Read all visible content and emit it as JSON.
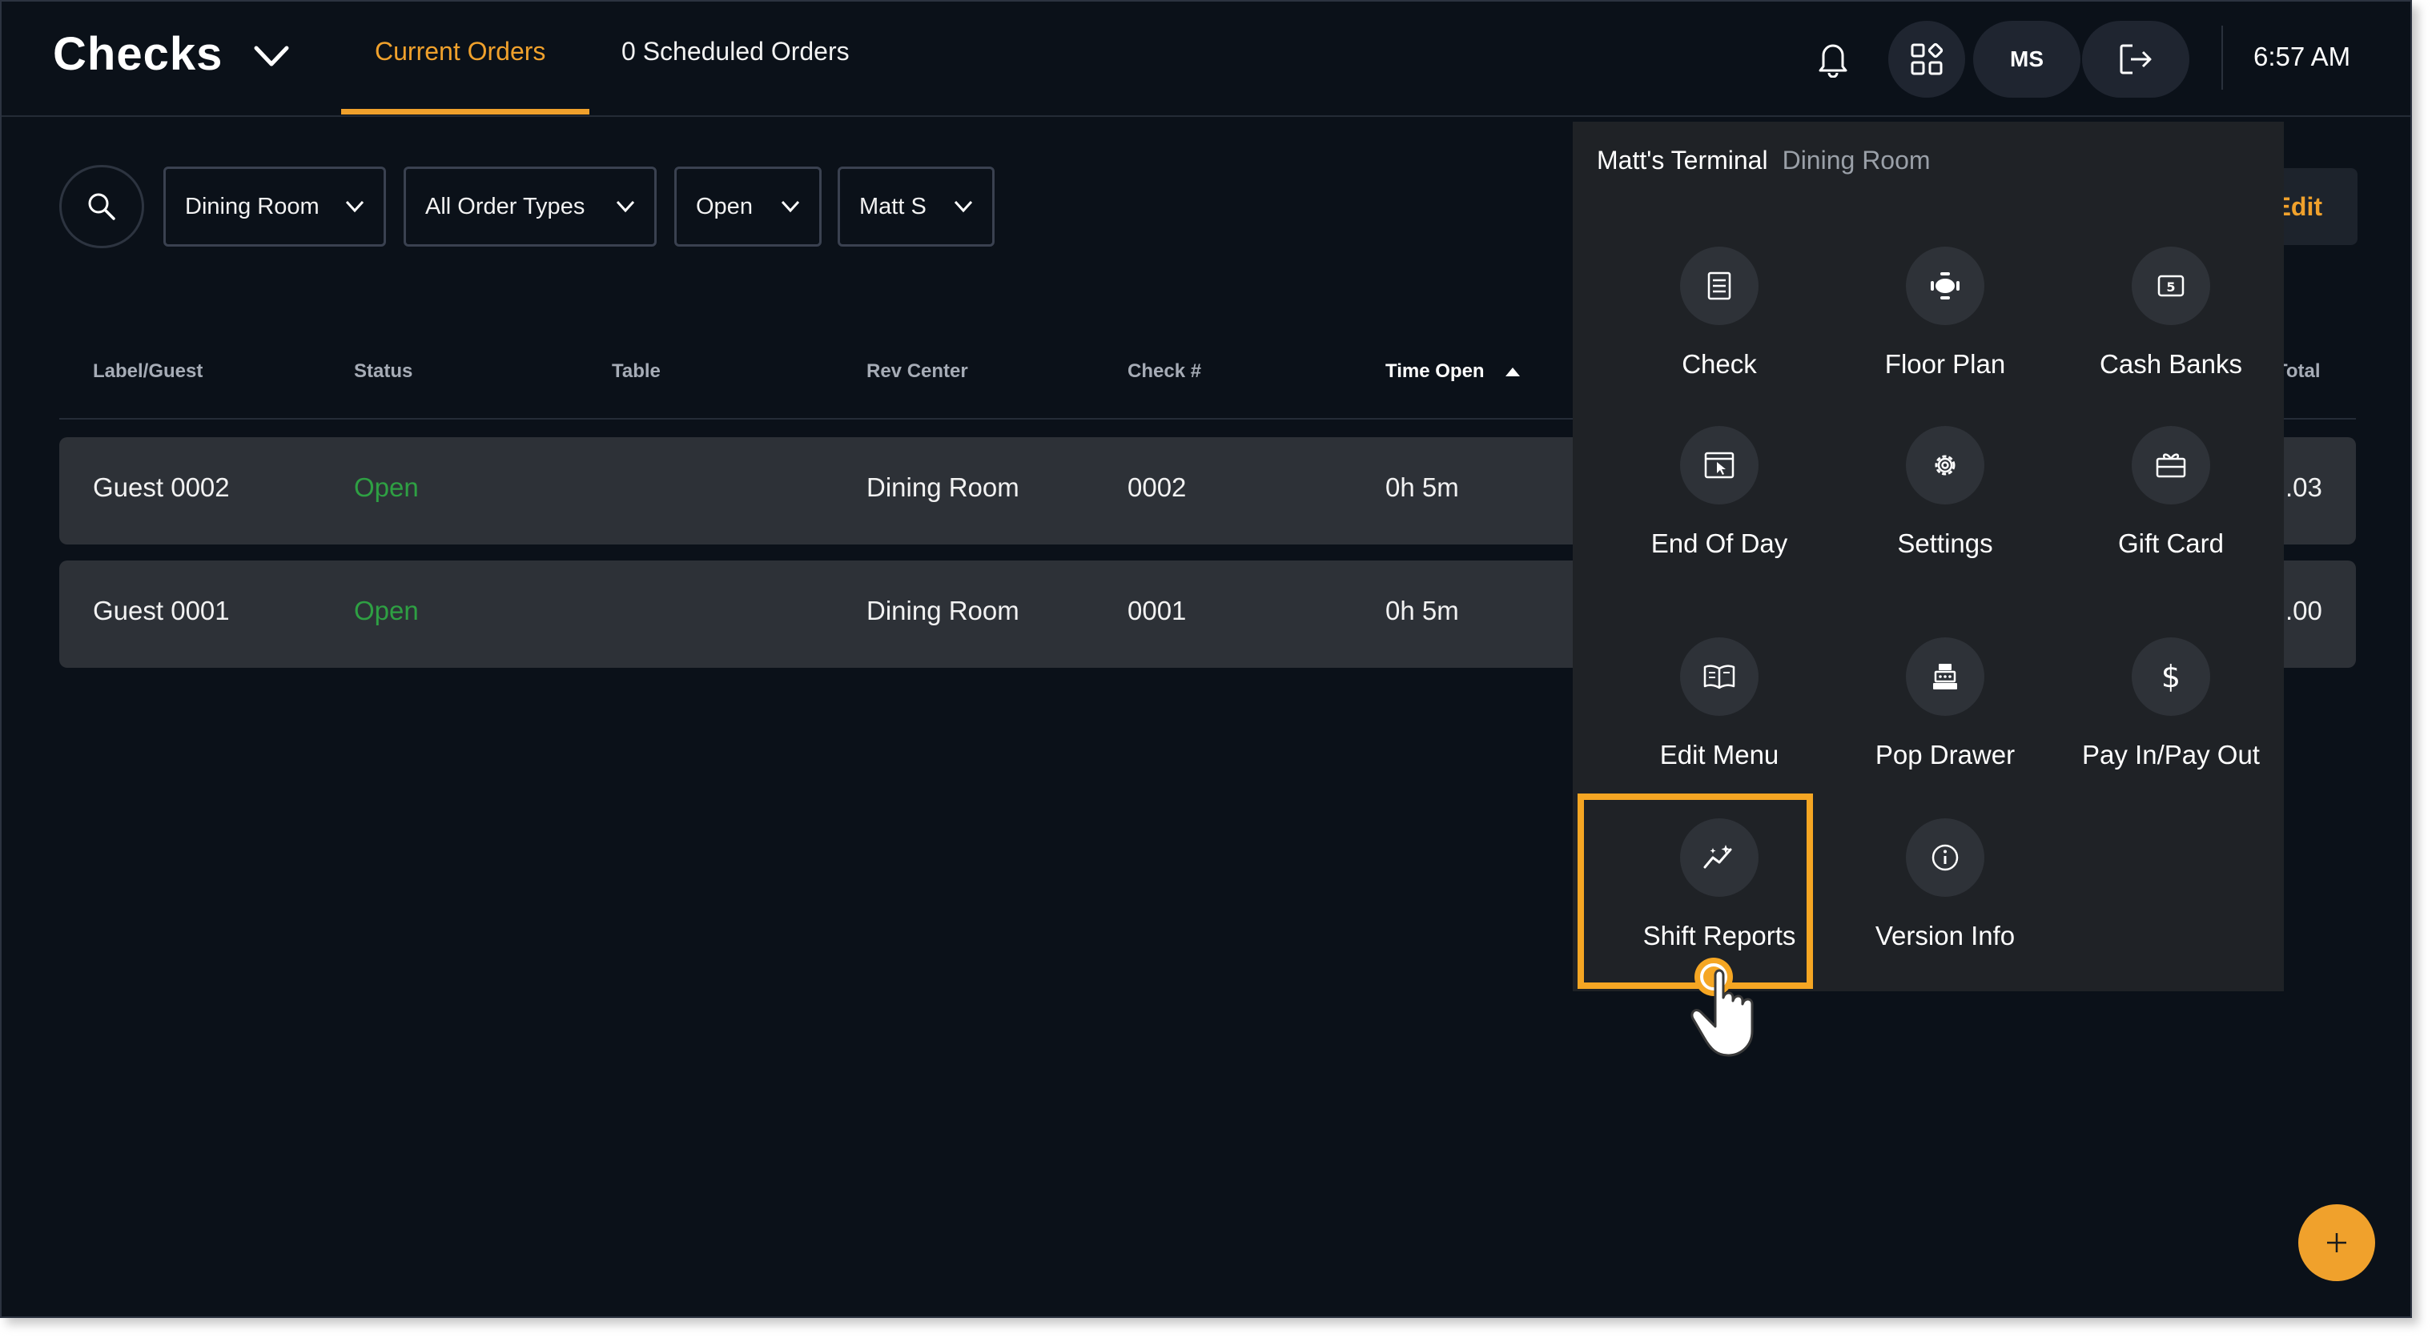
{
  "header": {
    "title": "Checks",
    "tabs": [
      {
        "label": "Current Orders",
        "active": true
      },
      {
        "label": "0 Scheduled Orders",
        "active": false
      }
    ],
    "user_initials": "MS",
    "time": "6:57 AM"
  },
  "filters": {
    "rev_center": "Dining Room",
    "order_types": "All Order Types",
    "status": "Open",
    "employee": "Matt S"
  },
  "edit_label": "Edit",
  "table": {
    "columns": [
      "Label/Guest",
      "Status",
      "Table",
      "Rev Center",
      "Check #",
      "Time Open",
      "Total"
    ],
    "rows": [
      {
        "guest": "Guest 0002",
        "status": "Open",
        "table": "",
        "rev_center": "Dining Room",
        "check": "0002",
        "time_open": "0h 5m",
        "total": ".03"
      },
      {
        "guest": "Guest 0001",
        "status": "Open",
        "table": "",
        "rev_center": "Dining Room",
        "check": "0001",
        "time_open": "0h 5m",
        "total": ".00"
      }
    ]
  },
  "menu": {
    "terminal": "Matt's Terminal",
    "room": "Dining Room",
    "items": [
      {
        "label": "Check",
        "icon": "receipt-icon"
      },
      {
        "label": "Floor Plan",
        "icon": "table-icon"
      },
      {
        "label": "Cash Banks",
        "icon": "cash-icon"
      },
      {
        "label": "End Of Day",
        "icon": "window-cursor-icon"
      },
      {
        "label": "Settings",
        "icon": "gear-icon"
      },
      {
        "label": "Gift Card",
        "icon": "gift-card-icon"
      },
      {
        "label": "Edit Menu",
        "icon": "book-icon"
      },
      {
        "label": "Pop Drawer",
        "icon": "cash-register-icon"
      },
      {
        "label": "Pay In/Pay Out",
        "icon": "dollar-icon"
      },
      {
        "label": "Shift Reports",
        "icon": "chart-sparkle-icon"
      },
      {
        "label": "Version Info",
        "icon": "info-icon"
      }
    ],
    "highlighted": "Shift Reports"
  },
  "colors": {
    "accent": "#f0a12c",
    "open_status": "#2ea043",
    "background": "#0b1119"
  }
}
